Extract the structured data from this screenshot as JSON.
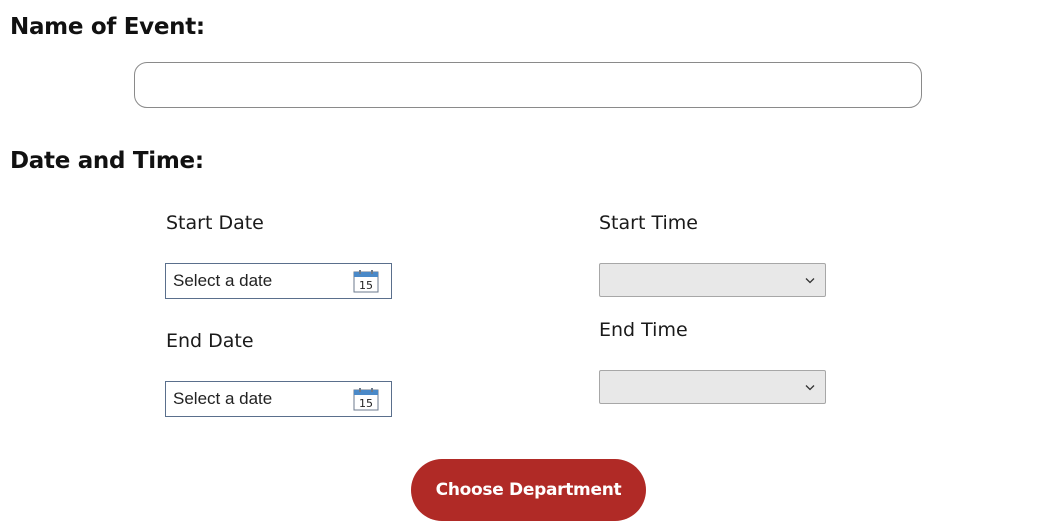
{
  "event": {
    "heading": "Name of Event:",
    "name_value": ""
  },
  "datetime": {
    "heading": "Date and Time:",
    "start_date": {
      "label": "Start Date",
      "value": "Select a date",
      "calendar_day": "15"
    },
    "end_date": {
      "label": "End Date",
      "value": "Select a date",
      "calendar_day": "15"
    },
    "start_time": {
      "label": "Start Time",
      "selected": ""
    },
    "end_time": {
      "label": "End Time",
      "selected": ""
    }
  },
  "actions": {
    "choose_department_label": "Choose Department"
  },
  "colors": {
    "button_bg": "#b02a26",
    "button_text": "#ffffff",
    "calendar_header": "#4a89c8"
  },
  "icons": {
    "calendar": "calendar-icon",
    "dropdown": "chevron-down-icon"
  }
}
